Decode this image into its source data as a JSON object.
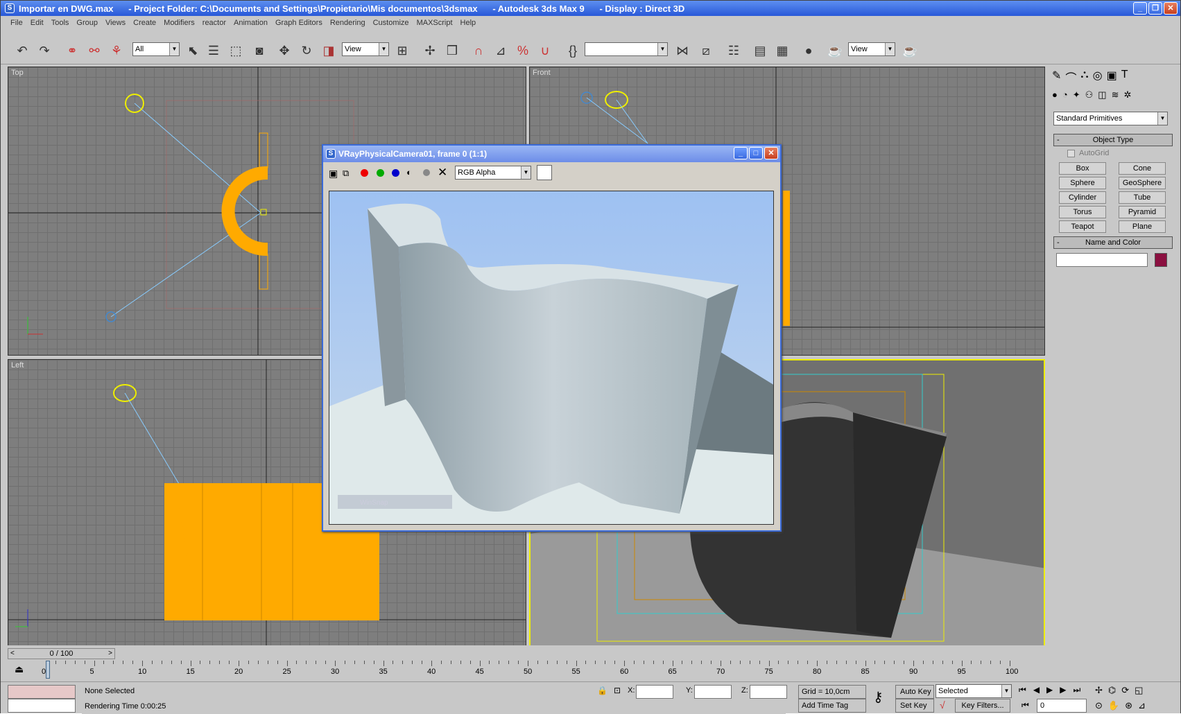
{
  "window": {
    "title": "Importar en DWG.max      - Project Folder: C:\\Documents and Settings\\Propietario\\Mis documentos\\3dsmax      - Autodesk 3ds Max 9      - Display : Direct 3D"
  },
  "menu": [
    "File",
    "Edit",
    "Tools",
    "Group",
    "Views",
    "Create",
    "Modifiers",
    "reactor",
    "Animation",
    "Graph Editors",
    "Rendering",
    "Customize",
    "MAXScript",
    "Help"
  ],
  "toolbar": {
    "selection_filter": "All",
    "ref_coord": "View",
    "named_selection": "",
    "view_dropdown": "View"
  },
  "viewports": {
    "top": "Top",
    "front": "Front",
    "left": "Left"
  },
  "frame_buffer": {
    "title": "VRayPhysicalCamera01, frame 0 (1:1)",
    "channel": "RGB Alpha",
    "watermark": "WinSnap"
  },
  "command_panel": {
    "category": "Standard Primitives",
    "object_type_header": "Object Type",
    "autogrid": "AutoGrid",
    "buttons": [
      "Box",
      "Cone",
      "Sphere",
      "GeoSphere",
      "Cylinder",
      "Tube",
      "Torus",
      "Pyramid",
      "Teapot",
      "Plane"
    ],
    "name_color_header": "Name and Color",
    "object_name": "",
    "object_color": "#8b1040"
  },
  "timeline": {
    "slider_label": "0 / 100",
    "ticks": [
      "0",
      "5",
      "10",
      "15",
      "20",
      "25",
      "30",
      "35",
      "40",
      "45",
      "50",
      "55",
      "60",
      "65",
      "70",
      "75",
      "80",
      "85",
      "90",
      "95",
      "100"
    ]
  },
  "status": {
    "selection": "None Selected",
    "prompt": "Rendering Time  0:00:25",
    "x_label": "X:",
    "y_label": "Y:",
    "z_label": "Z:",
    "grid": "Grid = 10,0cm",
    "auto_key": "Auto Key",
    "set_key": "Set Key",
    "key_mode": "Selected",
    "key_filters": "Key Filters...",
    "add_time_tag": "Add Time Tag",
    "current_frame": "0"
  }
}
